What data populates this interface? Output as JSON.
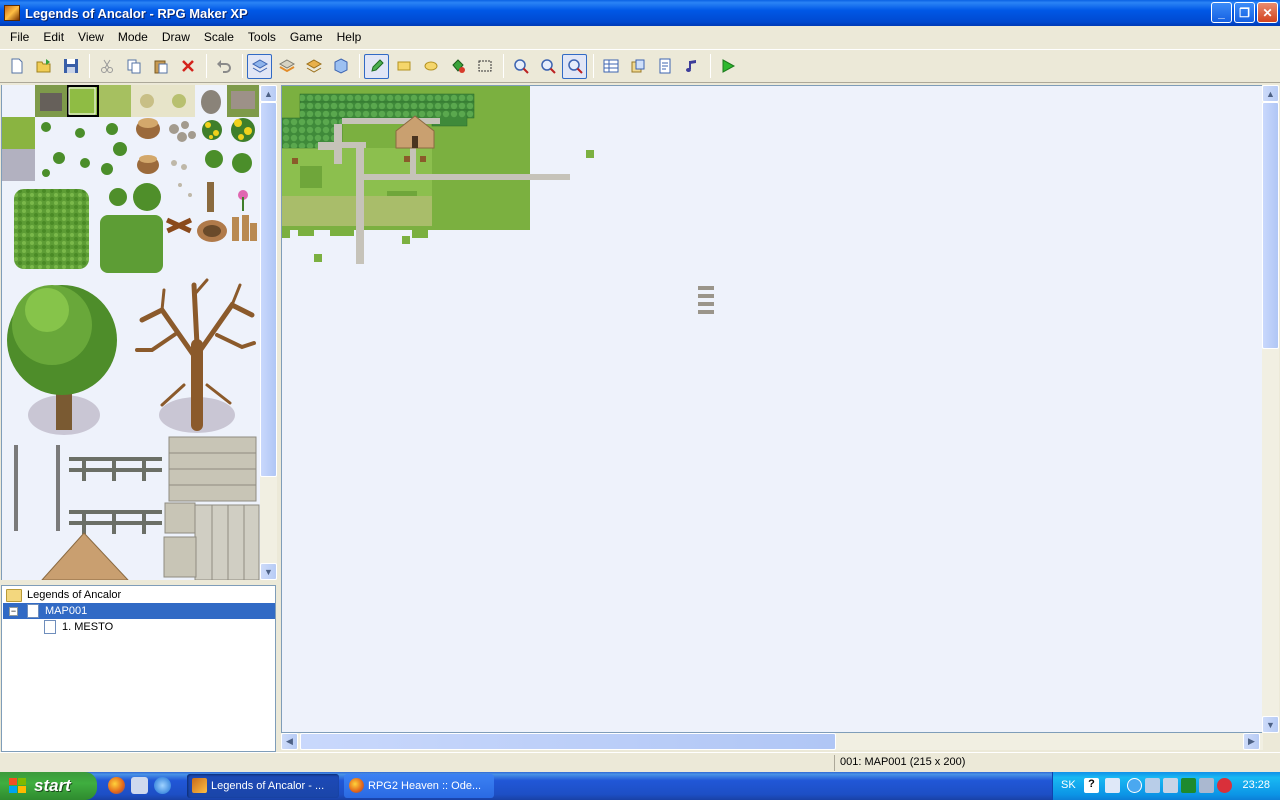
{
  "window": {
    "title": "Legends of Ancalor - RPG Maker XP"
  },
  "menu": [
    "File",
    "Edit",
    "View",
    "Mode",
    "Draw",
    "Scale",
    "Tools",
    "Game",
    "Help"
  ],
  "toolbar": {
    "buttons": [
      "new-project",
      "open-project",
      "save-project",
      "cut",
      "copy",
      "paste",
      "delete",
      "undo",
      "layer-1",
      "layer-2",
      "layer-3",
      "events-layer",
      "pencil",
      "rectangle",
      "ellipse",
      "flood-fill",
      "select",
      "zoom-1-1",
      "zoom-1-2",
      "zoom-1-4",
      "database",
      "materialbase",
      "script-editor",
      "sound-test",
      "playtest"
    ],
    "active": [
      "layer-1",
      "pencil",
      "zoom-1-4"
    ]
  },
  "map_tree": {
    "project": "Legends of Ancalor",
    "maps": [
      {
        "name": "MAP001",
        "selected": true,
        "children": [
          "1. MESTO"
        ]
      }
    ]
  },
  "status": {
    "map_info": "001: MAP001 (215 x 200)"
  },
  "taskbar": {
    "start": "start",
    "tasks": [
      "Legends of Ancalor - ...",
      "RPG2 Heaven :: Ode..."
    ],
    "tray_lang": "SK",
    "clock": "23:28"
  },
  "colors": {
    "xp_blue": "#0058e6",
    "grass": "#7cb342",
    "canvas": "#eef2fb",
    "selection": "#316ac5"
  }
}
